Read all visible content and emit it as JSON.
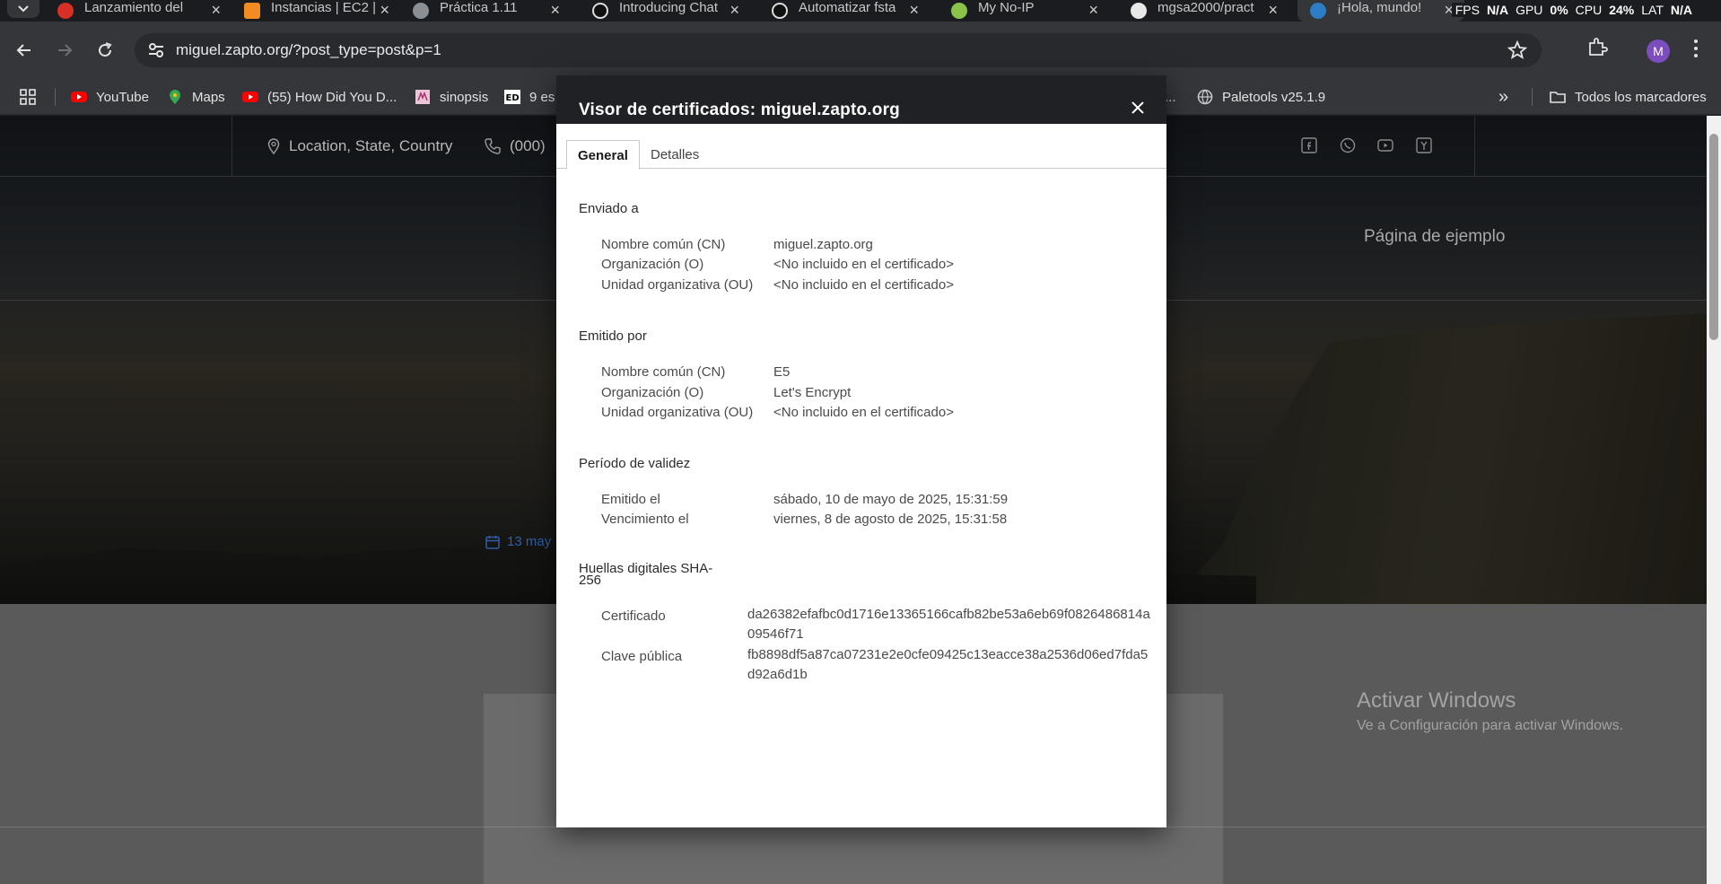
{
  "tabs": [
    {
      "title": "Lanzamiento del",
      "color": "#d93025"
    },
    {
      "title": "Instancias | EC2 |",
      "color": "#f28b22"
    },
    {
      "title": "Práctica 1.11",
      "color": "#8a8f96"
    },
    {
      "title": "Introducing Chat",
      "color": "#d0d0d0"
    },
    {
      "title": "Automatizar fsta",
      "color": "#d0d0d0"
    },
    {
      "title": "My No-IP",
      "color": "#8bc34a"
    },
    {
      "title": "mgsa2000/pract",
      "color": "#e8e8e8"
    },
    {
      "title": "¡Hola, mundo!",
      "color": "#2d7cc6"
    }
  ],
  "perf": {
    "fps_label": "FPS",
    "fps": "N/A",
    "gpu_label": "GPU",
    "gpu": "0%",
    "cpu_label": "CPU",
    "cpu": "24%",
    "lat_label": "LAT",
    "lat": "N/A"
  },
  "toolbar": {
    "url": "miguel.zapto.org/?post_type=post&p=1",
    "avatar": "M"
  },
  "bookmarks": {
    "items": [
      {
        "label": "YouTube"
      },
      {
        "label": "Maps"
      },
      {
        "label": "(55) How Did You D..."
      },
      {
        "label": "sinopsis"
      },
      {
        "label": "9 es"
      },
      {
        "label": "..."
      },
      {
        "label": "Paletools v25.1.9"
      }
    ],
    "overflow": "»",
    "all_label": "Todos los marcadores"
  },
  "site": {
    "location": "Location, State, Country",
    "phone": "(000)",
    "nav_item": "Página de ejemplo",
    "date": "13 may"
  },
  "watermark": {
    "title": "Activar Windows",
    "subtitle": "Ve a Configuración para activar Windows."
  },
  "cert": {
    "title": "Visor de certificados: miguel.zapto.org",
    "tabs": {
      "general": "General",
      "details": "Detalles"
    },
    "issued_to": {
      "heading": "Enviado a",
      "cn_label": "Nombre común (CN)",
      "cn": "miguel.zapto.org",
      "o_label": "Organización (O)",
      "o": "<No incluido en el certificado>",
      "ou_label": "Unidad organizativa (OU)",
      "ou": "<No incluido en el certificado>"
    },
    "issued_by": {
      "heading": "Emitido por",
      "cn_label": "Nombre común (CN)",
      "cn": "E5",
      "o_label": "Organización (O)",
      "o": "Let's Encrypt",
      "ou_label": "Unidad organizativa (OU)",
      "ou": "<No incluido en el certificado>"
    },
    "validity": {
      "heading": "Período de validez",
      "issued_label": "Emitido el",
      "issued": "sábado, 10 de mayo de 2025, 15:31:59",
      "expires_label": "Vencimiento el",
      "expires": "viernes, 8 de agosto de 2025, 15:31:58"
    },
    "fingerprints": {
      "heading_line1": "Huellas digitales SHA-",
      "heading_line2": "256",
      "cert_label": "Certificado",
      "cert": "da26382efafbc0d1716e13365166cafb82be53a6eb69f0826486814a09546f71",
      "pubkey_label": "Clave pública",
      "pubkey": "fb8898df5a87ca07231e2e0cfe09425c13eacce38a2536d06ed7fda5d92a6d1b"
    }
  }
}
